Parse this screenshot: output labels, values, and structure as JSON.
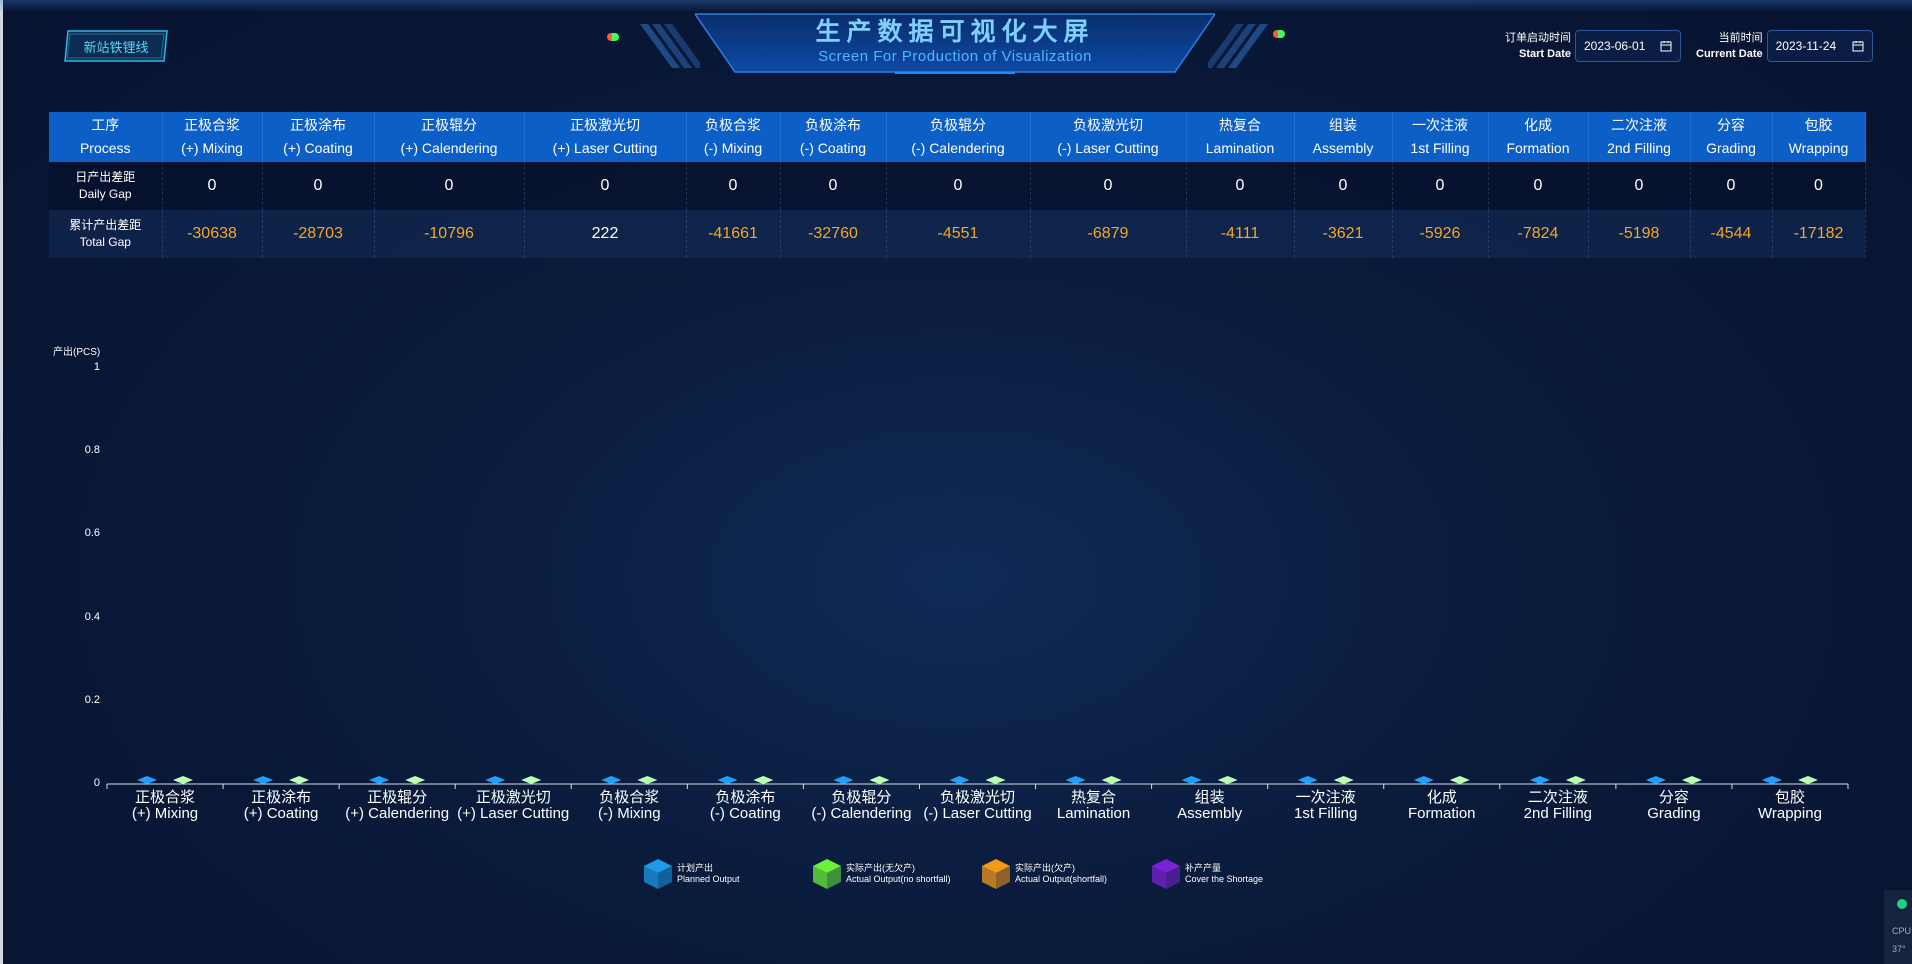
{
  "header": {
    "title": "生产数据可视化大屏",
    "subtitle": "Screen For Production of Visualization",
    "back_button": "新站铁锂线",
    "start_date_label_cn": "订单启动时间",
    "start_date_label_en": "Start Date",
    "start_date_value": "2023-06-01",
    "current_date_label_cn": "当前时间",
    "current_date_label_en": "Current Date",
    "current_date_value": "2023-11-24",
    "calendar_icon": "calendar-icon"
  },
  "table": {
    "head_label": {
      "cn": "工序",
      "en": "Process"
    },
    "columns": [
      {
        "cn": "正极合浆",
        "en": "(+) Mixing"
      },
      {
        "cn": "正极涂布",
        "en": "(+) Coating"
      },
      {
        "cn": "正极辊分",
        "en": "(+) Calendering"
      },
      {
        "cn": "正极激光切",
        "en": "(+) Laser Cutting"
      },
      {
        "cn": "负极合浆",
        "en": "(-) Mixing"
      },
      {
        "cn": "负极涂布",
        "en": "(-) Coating"
      },
      {
        "cn": "负极辊分",
        "en": "(-) Calendering"
      },
      {
        "cn": "负极激光切",
        "en": "(-) Laser Cutting"
      },
      {
        "cn": "热复合",
        "en": "Lamination"
      },
      {
        "cn": "组装",
        "en": "Assembly"
      },
      {
        "cn": "一次注液",
        "en": "1st Filling"
      },
      {
        "cn": "化成",
        "en": "Formation"
      },
      {
        "cn": "二次注液",
        "en": "2nd Filling"
      },
      {
        "cn": "分容",
        "en": "Grading"
      },
      {
        "cn": "包胶",
        "en": "Wrapping"
      }
    ],
    "rows": [
      {
        "label_cn": "日产出差距",
        "label_en": "Daily Gap",
        "values": [
          "0",
          "0",
          "0",
          "0",
          "0",
          "0",
          "0",
          "0",
          "0",
          "0",
          "0",
          "0",
          "0",
          "0",
          "0"
        ]
      },
      {
        "label_cn": "累计产出差距",
        "label_en": "Total Gap",
        "values": [
          "-30638",
          "-28703",
          "-10796",
          "222",
          "-41661",
          "-32760",
          "-4551",
          "-6879",
          "-4111",
          "-3621",
          "-5926",
          "-7824",
          "-5198",
          "-4544",
          "-17182"
        ]
      }
    ]
  },
  "chart_data": {
    "type": "bar",
    "ylabel": "产出(PCS)",
    "ylim": [
      0,
      1
    ],
    "yticks": [
      "0",
      "0.2",
      "0.4",
      "0.6",
      "0.8",
      "1"
    ],
    "categories": [
      {
        "cn": "正极合浆",
        "en": "(+) Mixing"
      },
      {
        "cn": "正极涂布",
        "en": "(+) Coating"
      },
      {
        "cn": "正极辊分",
        "en": "(+) Calendering"
      },
      {
        "cn": "正极激光切",
        "en": "(+) Laser Cutting"
      },
      {
        "cn": "负极合浆",
        "en": "(-) Mixing"
      },
      {
        "cn": "负极涂布",
        "en": "(-) Coating"
      },
      {
        "cn": "负极辊分",
        "en": "(-) Calendering"
      },
      {
        "cn": "负极激光切",
        "en": "(-) Laser Cutting"
      },
      {
        "cn": "热复合",
        "en": "Lamination"
      },
      {
        "cn": "组装",
        "en": "Assembly"
      },
      {
        "cn": "一次注液",
        "en": "1st Filling"
      },
      {
        "cn": "化成",
        "en": "Formation"
      },
      {
        "cn": "二次注液",
        "en": "2nd Filling"
      },
      {
        "cn": "分容",
        "en": "Grading"
      },
      {
        "cn": "包胶",
        "en": "Wrapping"
      }
    ],
    "series": [
      {
        "name": "计划产出 Planned Output",
        "color": "#1ea0ff",
        "values": [
          0,
          0,
          0,
          0,
          0,
          0,
          0,
          0,
          0,
          0,
          0,
          0,
          0,
          0,
          0
        ]
      },
      {
        "name": "实际产出(无欠产) Actual Output(no shortfall)",
        "color": "#b8ffb0",
        "values": [
          0,
          0,
          0,
          0,
          0,
          0,
          0,
          0,
          0,
          0,
          0,
          0,
          0,
          0,
          0
        ]
      }
    ],
    "legend": [
      {
        "cn": "计划产出",
        "en": "Planned Output",
        "color": "#1e9be8",
        "icon": "blue-cube-icon"
      },
      {
        "cn": "实际产出(无欠产)",
        "en": "Actual Output(no shortfall)",
        "color": "#6cf03c",
        "icon": "green-cube-icon"
      },
      {
        "cn": "实际产出(欠产)",
        "en": "Actual Output(shortfall)",
        "color": "#f49a1a",
        "icon": "orange-cube-icon"
      },
      {
        "cn": "补产产量",
        "en": "Cover the Shortage",
        "color": "#7b22d6",
        "icon": "purple-cube-icon"
      }
    ]
  },
  "side_widget": {
    "label": "CPU",
    "value": "37°"
  },
  "colors": {
    "accent": "#0b5fc7",
    "negative": "#f6a623",
    "title": "#7fd0ff"
  }
}
